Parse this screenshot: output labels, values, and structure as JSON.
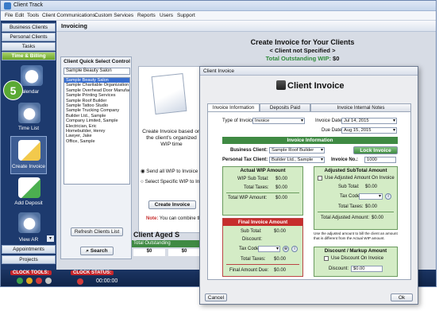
{
  "window": {
    "title": "Client Track"
  },
  "menu": [
    "File",
    "Edit",
    "Tools",
    "Client Communications",
    "Custom Services",
    "Reports",
    "Users",
    "Support"
  ],
  "nav": {
    "tabs": [
      "Business Clients",
      "Personal Clients",
      "Tasks",
      "Time & Billing"
    ],
    "items": [
      "Calendar",
      "Time List",
      "Create Invoice",
      "Add Deposit",
      "View AR"
    ],
    "bottom_tabs": [
      "Appointments",
      "Projects"
    ],
    "step": "5"
  },
  "content": {
    "header": "Invoicing",
    "title": "Create Invoice for Your Clients",
    "subtitle": "< Client not Specified >",
    "outstanding_label": "Total Outstanding WIP:",
    "outstanding_value": "$0",
    "quick_panel_title": "Client Quick Select Control",
    "search_value": "Sample Beauty Salon",
    "clients": [
      "Sample Beauty Salon",
      "Sample Charitable Organization",
      "Sample Overhead Door Manufact.",
      "Sample Printing Services",
      "Sample Roof Builder",
      "Sample Tattoo Studio",
      "Sample Trucking Company",
      "Builder Ltd., Sample",
      "Company Limited, Sample",
      "Electrician, Eric",
      "Homebuilder, Henry",
      "Lawyer, Jake",
      "Office, Sample"
    ],
    "refresh_button": "Refresh Clients List",
    "search_button": "Search",
    "wizard_text": "Create Invoice based on the client's organized WIP time",
    "option1": "Send all WIP to Invoice",
    "option2": "Select Specific WIP to Invoice",
    "create_button": "Create Invoice",
    "note_label": "Note:",
    "note_text": "You can combine the",
    "aged_title": "Client Aged S",
    "total_outstanding": "Total Outstanding",
    "aged_value1": "$0",
    "aged_value2": "$0"
  },
  "bottombar": {
    "clock_tools": "CLOCK TOOLS:",
    "clock_status": "CLOCK STATUS:",
    "time": "00:00:00"
  },
  "dialog": {
    "window_title": "Client Invoice",
    "heading": "Client Invoice",
    "tabs": [
      "Invoice Information",
      "Deposits Paid",
      "Invoice Internal Notes"
    ],
    "type_label": "Type of Invoice:",
    "type_value": "Invoice",
    "invoice_date_label": "Invoice Date:",
    "invoice_date": "Jul 14, 2015",
    "due_date_label": "Due Date:",
    "due_date": "Aug 15, 2015",
    "info_bar": "Invoice Information",
    "business_client_label": "Business Client:",
    "business_client": "Sample Roof Builder",
    "personal_tax_label": "Personal Tax Client:",
    "personal_tax": "Builder Ltd., Sample",
    "lock_button": "Lock Invoice",
    "invoice_no_label": "Invoice No.:",
    "invoice_no": "1000",
    "actual_wip": {
      "title": "Actual WIP Amount",
      "subtotal_label": "WIP Sub Total:",
      "subtotal": "$0.00",
      "taxes_label": "Total Taxes:",
      "taxes": "$0.00",
      "total_label": "Total WIP Amount:",
      "total": "$0.00"
    },
    "adjusted": {
      "title": "Adjusted SubTotal Amount",
      "use_label": "Use Adjusted Amount On Invoice",
      "subtotal_label": "Sub Total:",
      "subtotal": "$0.00",
      "taxcode_label": "Tax Code:",
      "taxes_label": "Total Taxes:",
      "taxes": "$0.00",
      "total_label": "Total Adjusted Amount:",
      "total": "$0.00",
      "note": "Use the adjusted amount to bill the client an amount that is different from the Actual WIP amount."
    },
    "final": {
      "title": "Final Invoice Amount",
      "subtotal_label": "Sub Total:",
      "subtotal": "$0.00",
      "discount_label": "Discount:",
      "taxcode_label": "Tax Code:",
      "taxes_label": "Total Taxes:",
      "taxes": "$0.00",
      "due_label": "Final Amount Due:",
      "due": "$0.00"
    },
    "discount": {
      "title": "Discount / Markup Amount",
      "use_label": "Use Discount On Invoice",
      "discount_label": "Discount:",
      "discount_value": "$0.00"
    },
    "cancel_button": "Cancel",
    "ok_button": "Ok"
  },
  "colors": {
    "nav_bg": "#1d3a6e",
    "green_accent": "#3f8a43",
    "red_accent": "#c62d2d",
    "panel_green": "#d4ecc6",
    "step_badge": "#5aa934"
  }
}
